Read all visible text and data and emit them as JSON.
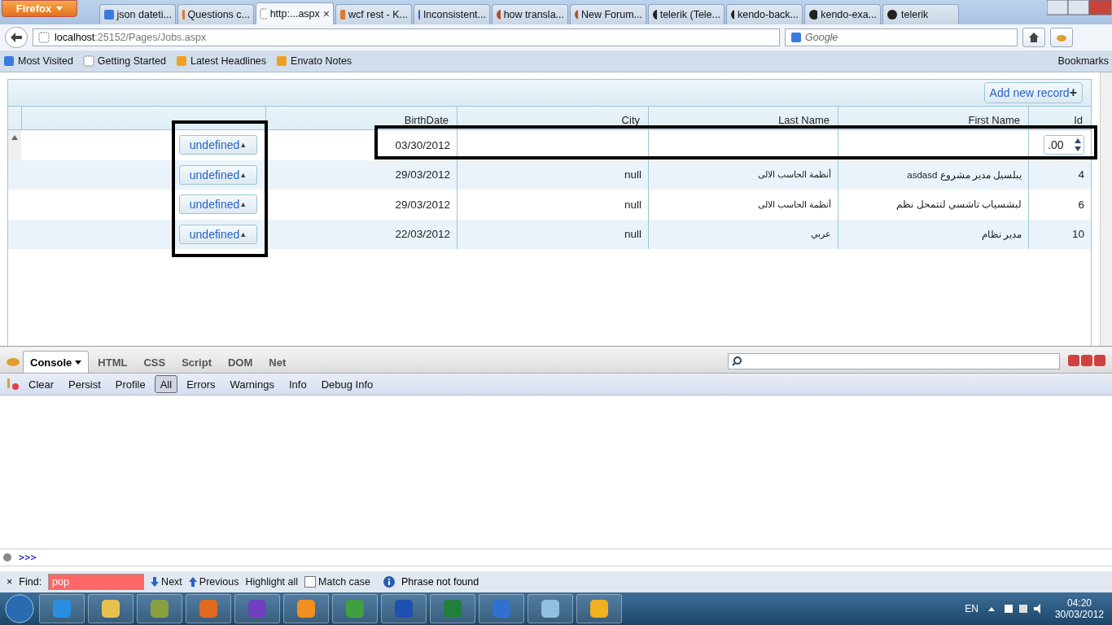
{
  "browser": {
    "menu_button": "Firefox",
    "tabs": [
      {
        "label": "json dateti...",
        "kind": "google",
        "selected": false
      },
      {
        "label": "Questions c...",
        "kind": "stack",
        "selected": false
      },
      {
        "label": "http:...aspx",
        "kind": "page",
        "selected": true,
        "close": "×"
      },
      {
        "label": "wcf rest - K...",
        "kind": "stack",
        "selected": false
      },
      {
        "label": "Inconsistent...",
        "kind": "kendo",
        "selected": false
      },
      {
        "label": "how transla...",
        "kind": "forum",
        "selected": false
      },
      {
        "label": "New Forum...",
        "kind": "forum",
        "selected": false
      },
      {
        "label": "telerik (Tele...",
        "kind": "github",
        "selected": false
      },
      {
        "label": "kendo-back...",
        "kind": "github",
        "selected": false
      },
      {
        "label": "kendo-exa...",
        "kind": "github",
        "selected": false
      },
      {
        "label": "telerik",
        "kind": "github",
        "selected": false
      }
    ],
    "url_host": "localhost",
    "url_path": ":25152/Pages/Jobs.aspx",
    "search_placeholder": "Google",
    "bookmarks": [
      {
        "label": "Most Visited",
        "kind": "visited"
      },
      {
        "label": "Getting Started",
        "kind": "page"
      },
      {
        "label": "Latest Headlines",
        "kind": "feed"
      },
      {
        "label": "Envato Notes",
        "kind": "feed"
      }
    ],
    "bookmarks_menu": "Bookmarks"
  },
  "grid": {
    "add_button": "Add new record",
    "add_symbol": "+",
    "columns": [
      {
        "label": "BirthDate"
      },
      {
        "label": "City"
      },
      {
        "label": "Last Name"
      },
      {
        "label": "First Name"
      },
      {
        "label": "Id"
      }
    ],
    "edit_row": {
      "button": "undefined",
      "caret": "▲",
      "birthdate": "03/30/2012",
      "id_value": ".00"
    },
    "rows": [
      {
        "button": "undefined",
        "caret": "▲",
        "birthdate": "29/03/2012",
        "city": "null",
        "last_name": "أنظمة الحاسب الالى",
        "first_name": "asdasd يبلسيل مدير مشروع",
        "id": "4"
      },
      {
        "button": "undefined",
        "caret": "▲",
        "birthdate": "29/03/2012",
        "city": "null",
        "last_name": "أنظمة الحاسب الالى",
        "first_name": "لبشسياب تاشسي لتتمحل نظم",
        "id": "6"
      },
      {
        "button": "undefined",
        "caret": "▲",
        "birthdate": "22/03/2012",
        "city": "null",
        "last_name": "عربي",
        "first_name": "مدير نظام",
        "id": "10"
      }
    ]
  },
  "firebug": {
    "tabs": [
      {
        "label": "Console",
        "selected": true
      },
      {
        "label": "HTML",
        "selected": false
      },
      {
        "label": "CSS",
        "selected": false
      },
      {
        "label": "Script",
        "selected": false
      },
      {
        "label": "DOM",
        "selected": false
      },
      {
        "label": "Net",
        "selected": false
      }
    ],
    "actions": [
      "Clear",
      "Persist",
      "Profile"
    ],
    "filters": [
      {
        "label": "All",
        "selected": true
      },
      {
        "label": "Errors",
        "selected": false
      },
      {
        "label": "Warnings",
        "selected": false
      },
      {
        "label": "Info",
        "selected": false
      },
      {
        "label": "Debug Info",
        "selected": false
      }
    ],
    "prompt": ">>>"
  },
  "find_bar": {
    "close": "×",
    "label": "Find:",
    "value": "pop",
    "not_found": true,
    "next": "Next",
    "previous": "Previous",
    "highlight_all": "Highlight all",
    "match_case": {
      "label": "Match case",
      "checked": false
    },
    "status": "Phrase not found"
  },
  "taskbar": {
    "apps": [
      {
        "kind": "ie"
      },
      {
        "kind": "folder"
      },
      {
        "kind": "tools"
      },
      {
        "kind": "firefox"
      },
      {
        "kind": "vs"
      },
      {
        "kind": "vmware"
      },
      {
        "kind": "monitor"
      },
      {
        "kind": "word"
      },
      {
        "kind": "excel"
      },
      {
        "kind": "itunes"
      },
      {
        "kind": "notepad"
      },
      {
        "kind": "winamp"
      }
    ],
    "language": "EN",
    "time": "04:20",
    "date": "30/03/2012"
  }
}
